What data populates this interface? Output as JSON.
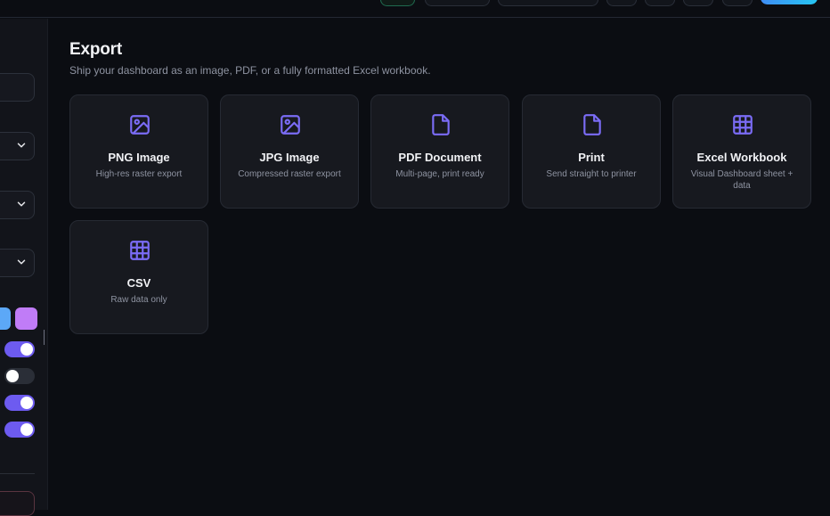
{
  "colors": {
    "accent": "#6d5bf0",
    "icon": "#7b6cf6",
    "swatch_blue": "#5ca8f7",
    "swatch_purple": "#c07cf7",
    "primary_gradient_start": "#3f8df5",
    "primary_gradient_end": "#26c6f2"
  },
  "sidebar": {
    "toggles": [
      {
        "name": "toggle-1",
        "on": true
      },
      {
        "name": "toggle-2",
        "on": false
      },
      {
        "name": "toggle-3",
        "on": true
      },
      {
        "name": "toggle-4",
        "on": true
      }
    ]
  },
  "export": {
    "title": "Export",
    "subtitle": "Ship your dashboard as an image, PDF, or a fully formatted Excel workbook.",
    "options": [
      {
        "icon": "image-icon",
        "name": "PNG Image",
        "desc": "High-res raster export"
      },
      {
        "icon": "image-icon",
        "name": "JPG Image",
        "desc": "Compressed raster export"
      },
      {
        "icon": "document-icon",
        "name": "PDF Document",
        "desc": "Multi-page, print ready"
      },
      {
        "icon": "document-icon",
        "name": "Print",
        "desc": "Send straight to printer"
      },
      {
        "icon": "grid-icon",
        "name": "Excel Workbook",
        "desc": "Visual Dashboard sheet + data"
      },
      {
        "icon": "grid-icon",
        "name": "CSV",
        "desc": "Raw data only"
      }
    ]
  }
}
